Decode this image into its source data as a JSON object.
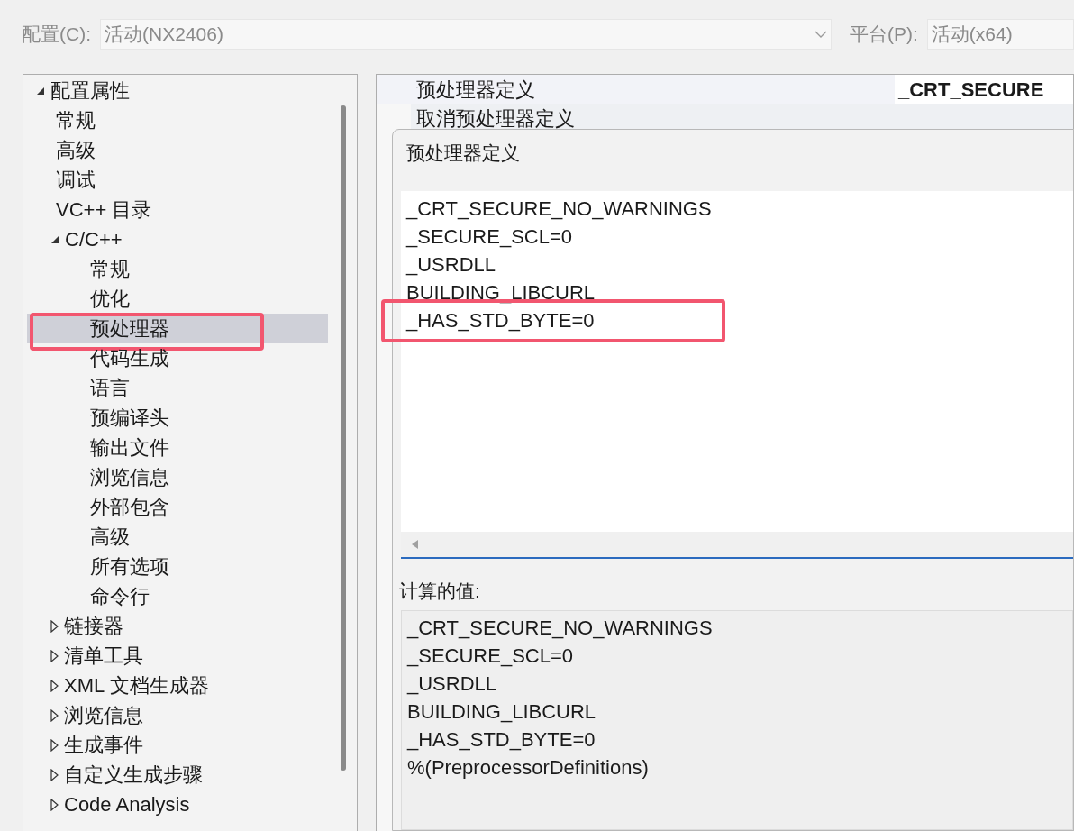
{
  "toolbar": {
    "config_label": "配置(C):",
    "config_value": "活动(NX2406)",
    "platform_label": "平台(P):",
    "platform_value": "活动(x64)"
  },
  "tree": [
    {
      "label": "配置属性",
      "expanded": true,
      "selected": false,
      "highlighted": false,
      "children": [
        {
          "label": "常规",
          "selected": false,
          "highlighted": false
        },
        {
          "label": "高级",
          "selected": false,
          "highlighted": false
        },
        {
          "label": "调试",
          "selected": false,
          "highlighted": false
        },
        {
          "label": "VC++ 目录",
          "selected": false,
          "highlighted": false
        },
        {
          "label": "C/C++",
          "expanded": true,
          "selected": false,
          "highlighted": false,
          "children": [
            {
              "label": "常规",
              "selected": false,
              "highlighted": false
            },
            {
              "label": "优化",
              "selected": false,
              "highlighted": false
            },
            {
              "label": "预处理器",
              "selected": true,
              "highlighted": true
            },
            {
              "label": "代码生成",
              "selected": false,
              "highlighted": false
            },
            {
              "label": "语言",
              "selected": false,
              "highlighted": false
            },
            {
              "label": "预编译头",
              "selected": false,
              "highlighted": false
            },
            {
              "label": "输出文件",
              "selected": false,
              "highlighted": false
            },
            {
              "label": "浏览信息",
              "selected": false,
              "highlighted": false
            },
            {
              "label": "外部包含",
              "selected": false,
              "highlighted": false
            },
            {
              "label": "高级",
              "selected": false,
              "highlighted": false
            },
            {
              "label": "所有选项",
              "selected": false,
              "highlighted": false
            },
            {
              "label": "命令行",
              "selected": false,
              "highlighted": false
            }
          ]
        },
        {
          "label": "链接器",
          "expanded": false,
          "selected": false,
          "highlighted": false
        },
        {
          "label": "清单工具",
          "expanded": false,
          "selected": false,
          "highlighted": false
        },
        {
          "label": "XML 文档生成器",
          "expanded": false,
          "selected": false,
          "highlighted": false
        },
        {
          "label": "浏览信息",
          "expanded": false,
          "selected": false,
          "highlighted": false
        },
        {
          "label": "生成事件",
          "expanded": false,
          "selected": false,
          "highlighted": false
        },
        {
          "label": "自定义生成步骤",
          "expanded": false,
          "selected": false,
          "highlighted": false
        },
        {
          "label": "Code Analysis",
          "expanded": false,
          "selected": false,
          "highlighted": false
        }
      ]
    }
  ],
  "property_grid": {
    "rows": [
      {
        "name": "预处理器定义",
        "value": "_CRT_SECURE"
      },
      {
        "name": "取消预处理器定义"
      }
    ]
  },
  "dialog": {
    "title": "预处理器定义",
    "lines": [
      {
        "text": "_CRT_SECURE_NO_WARNINGS",
        "highlighted": false
      },
      {
        "text": "_SECURE_SCL=0",
        "highlighted": false
      },
      {
        "text": "_USRDLL",
        "highlighted": false
      },
      {
        "text": "BUILDING_LIBCURL",
        "highlighted": false
      },
      {
        "text": "_HAS_STD_BYTE=0",
        "highlighted": true
      }
    ],
    "computed_label": "计算的值:",
    "computed_lines": [
      "_CRT_SECURE_NO_WARNINGS",
      "_SECURE_SCL=0",
      "_USRDLL",
      "BUILDING_LIBCURL",
      "_HAS_STD_BYTE=0",
      "%(PreprocessorDefinitions)"
    ]
  }
}
